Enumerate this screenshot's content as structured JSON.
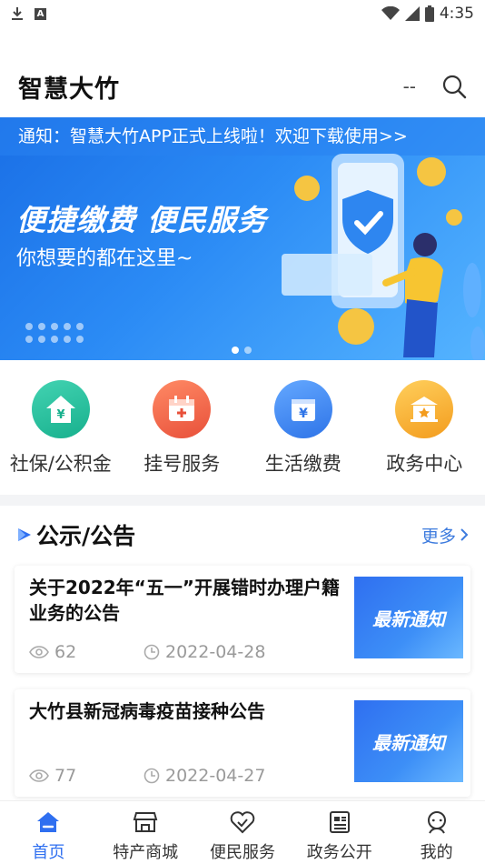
{
  "status_bar": {
    "time": "4:35"
  },
  "header": {
    "title": "智慧大竹",
    "dash": "--"
  },
  "banner": {
    "notice": "通知：智慧大竹APP正式上线啦！欢迎下载使用>>",
    "headline": "便捷缴费 便民服务",
    "subline": "你想要的都在这里~",
    "page_index": 1,
    "page_count": 2
  },
  "services": [
    {
      "label": "社保/公积金",
      "icon": "social-security-icon",
      "color": "#2fc6a4"
    },
    {
      "label": "挂号服务",
      "icon": "hospital-registration-icon",
      "color": "#f2684f"
    },
    {
      "label": "生活缴费",
      "icon": "bill-payment-icon",
      "color": "#3f8df5"
    },
    {
      "label": "政务中心",
      "icon": "government-center-icon",
      "color": "#f6b23b"
    }
  ],
  "announcements": {
    "title": "公示/公告",
    "more": "更多",
    "items": [
      {
        "title": "关于2022年“五一”开展错时办理户籍业务的公告",
        "views": "62",
        "date": "2022-04-28",
        "thumb_text": "最新通知"
      },
      {
        "title": "大竹县新冠病毒疫苗接种公告",
        "views": "77",
        "date": "2022-04-27",
        "thumb_text": "最新通知"
      }
    ]
  },
  "bottom_nav": [
    {
      "label": "首页",
      "icon": "home-icon",
      "active": true
    },
    {
      "label": "特产商城",
      "icon": "store-icon",
      "active": false
    },
    {
      "label": "便民服务",
      "icon": "handshake-heart-icon",
      "active": false
    },
    {
      "label": "政务公开",
      "icon": "news-document-icon",
      "active": false
    },
    {
      "label": "我的",
      "icon": "profile-icon",
      "active": false
    }
  ],
  "colors": {
    "accent": "#2f6ff0",
    "link": "#3d7bde",
    "banner": "#2b8bf5"
  }
}
